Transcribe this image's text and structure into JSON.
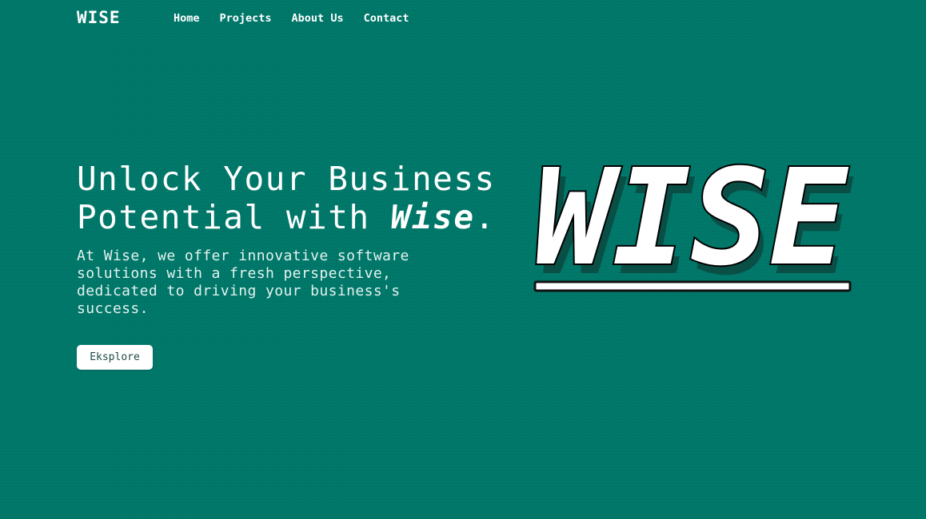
{
  "nav": {
    "brand": "WISE",
    "links": [
      "Home",
      "Projects",
      "About Us",
      "Contact"
    ]
  },
  "hero": {
    "title_line1": "Unlock Your Business",
    "title_line2_prefix": "Potential with ",
    "title_emphasis": "Wise",
    "title_suffix": ".",
    "description": "At Wise, we offer innovative software solutions with a fresh perspective, dedicated to driving your business's success.",
    "cta_label": "Eksplore",
    "logo_text": "WISE"
  },
  "colors": {
    "background": "#00796b",
    "text": "#ffffff",
    "button_bg": "#ffffff",
    "button_text": "#1f4a45",
    "logo_shadow": "#0a4f46"
  }
}
